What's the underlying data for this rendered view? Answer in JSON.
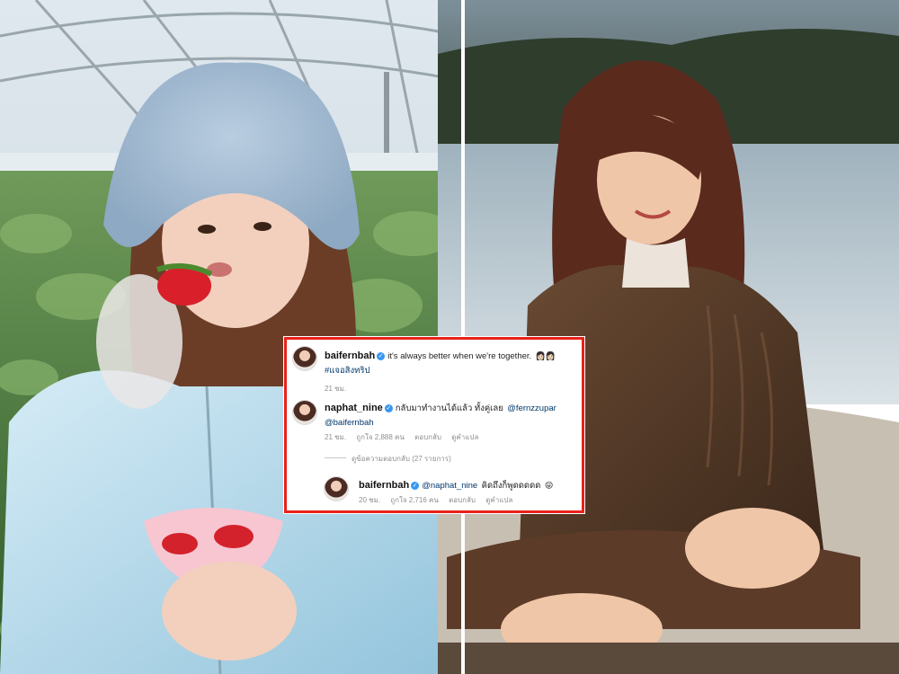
{
  "post": {
    "username": "baifernbah",
    "caption": "it's always better when we're together.",
    "caption_emoji": "👩🏻👩🏻",
    "hashtag": "#แจอสิงทริป",
    "time": "21 ชม."
  },
  "comment": {
    "username": "naphat_nine",
    "text": "กลับมาทำงานได้แล้ว ทั้งคู่เลย",
    "mention1": "@fernzzupar",
    "mention2": "@baifernbah",
    "time": "21 ชม.",
    "likes": "ถูกใจ 2,888 คน",
    "reply_label": "ตอบกลับ",
    "translate_label": "ดูคำแปล"
  },
  "view_replies": "ดูข้อความตอบกลับ (27 รายการ)",
  "reply": {
    "username": "baifernbah",
    "mention": "@naphat_nine",
    "text": "คิดถึงก็พูดดดดด",
    "emoji": "😛",
    "time": "20 ชม.",
    "likes": "ถูกใจ 2,716 คน",
    "reply_label": "ตอบกลับ",
    "translate_label": "ดูคำแปล"
  },
  "colors": {
    "highlight_border": "#e8221b",
    "verified": "#3897f0",
    "meta_text": "#8e8e8e"
  }
}
